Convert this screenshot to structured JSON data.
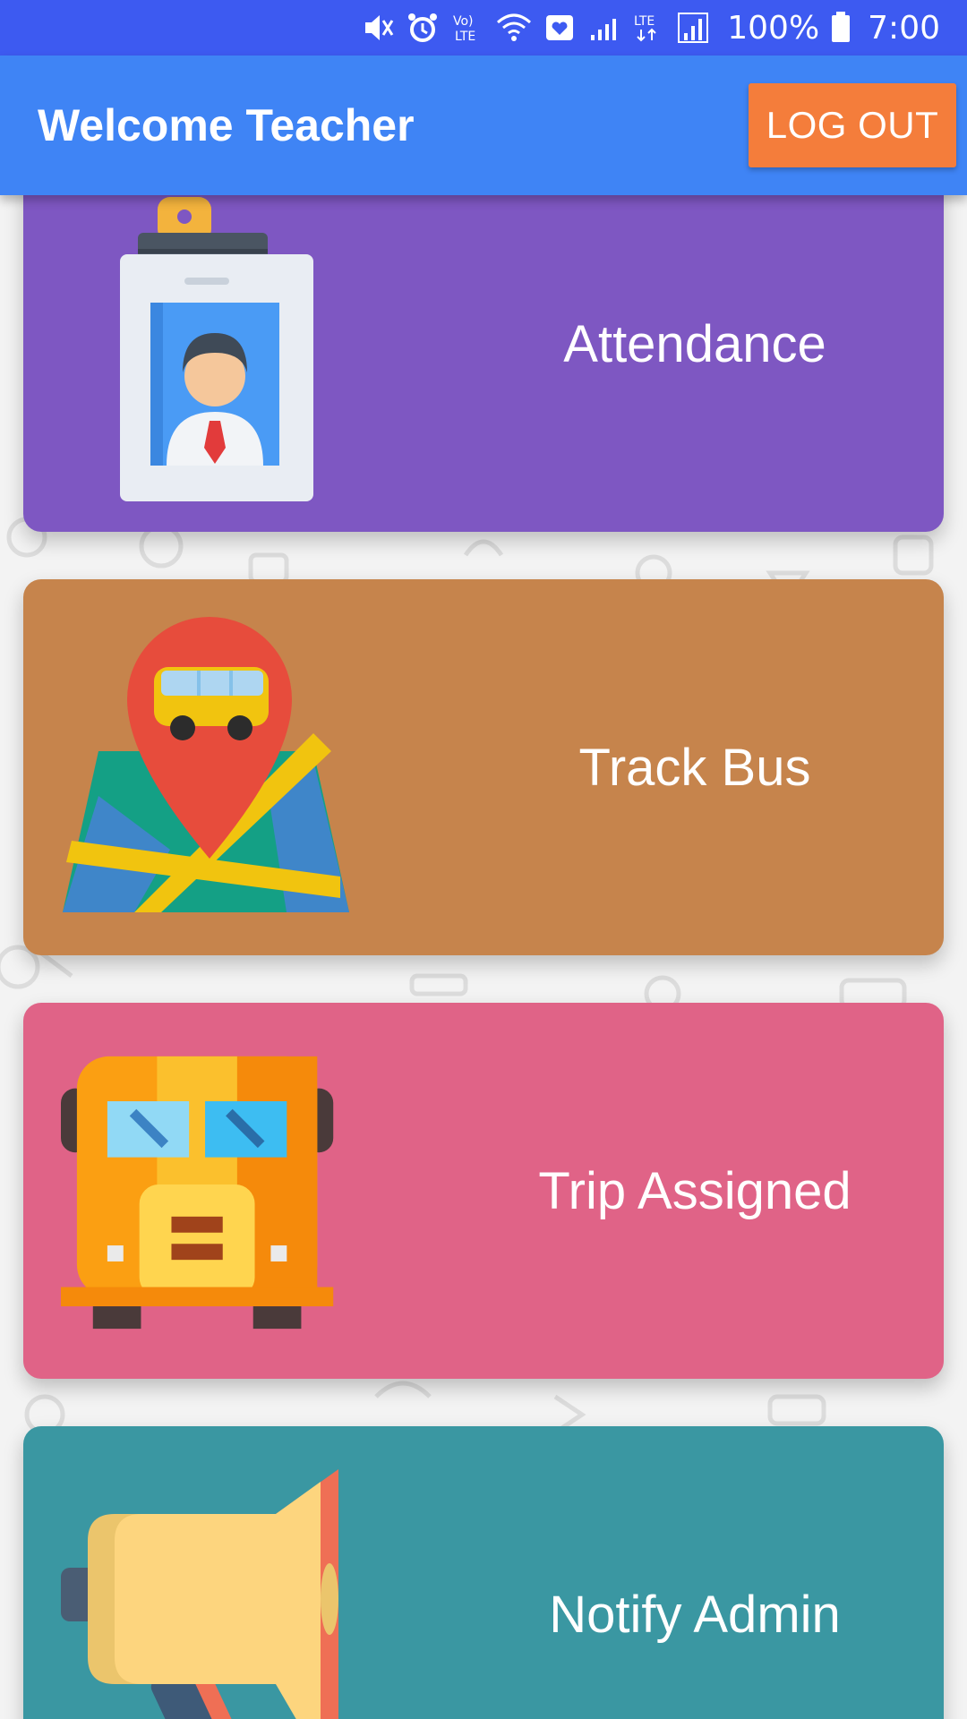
{
  "status_bar": {
    "battery": "100%",
    "time": "7:00",
    "icons": [
      "mute-icon",
      "alarm-icon",
      "volte-icon",
      "wifi-icon",
      "health-icon",
      "signal-icon",
      "lte-icon",
      "signal-icon",
      "battery-icon"
    ]
  },
  "app_bar": {
    "title": "Welcome Teacher",
    "logout_label": "LOG OUT",
    "color": "#3f84f5",
    "logout_color": "#f47d3b"
  },
  "menu": [
    {
      "label": "Attendance",
      "icon": "id-badge-icon",
      "color": "#7e57c2"
    },
    {
      "label": "Track Bus",
      "icon": "map-pin-bus-icon",
      "color": "#c6844c"
    },
    {
      "label": "Trip Assigned",
      "icon": "school-bus-icon",
      "color": "#e06387"
    },
    {
      "label": "Notify Admin",
      "icon": "megaphone-icon",
      "color": "#3a97a2"
    }
  ]
}
